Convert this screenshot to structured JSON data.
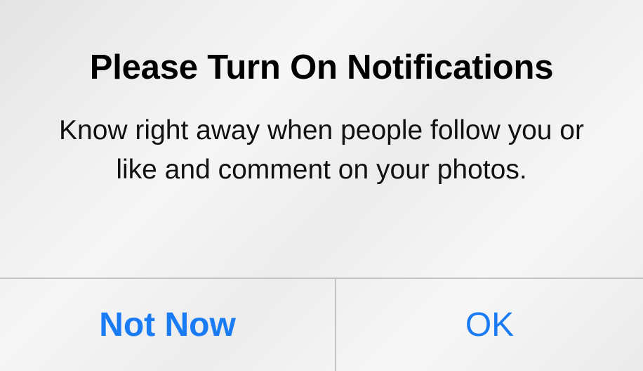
{
  "dialog": {
    "title": "Please Turn On Notifications",
    "message": "Know right away when people follow you or like and comment on your photos.",
    "buttons": {
      "not_now": "Not Now",
      "ok": "OK"
    }
  },
  "colors": {
    "button_text": "#1a7cf5",
    "title_text": "#000000",
    "divider": "#c4c4c4",
    "background": "#f1f1f1"
  }
}
